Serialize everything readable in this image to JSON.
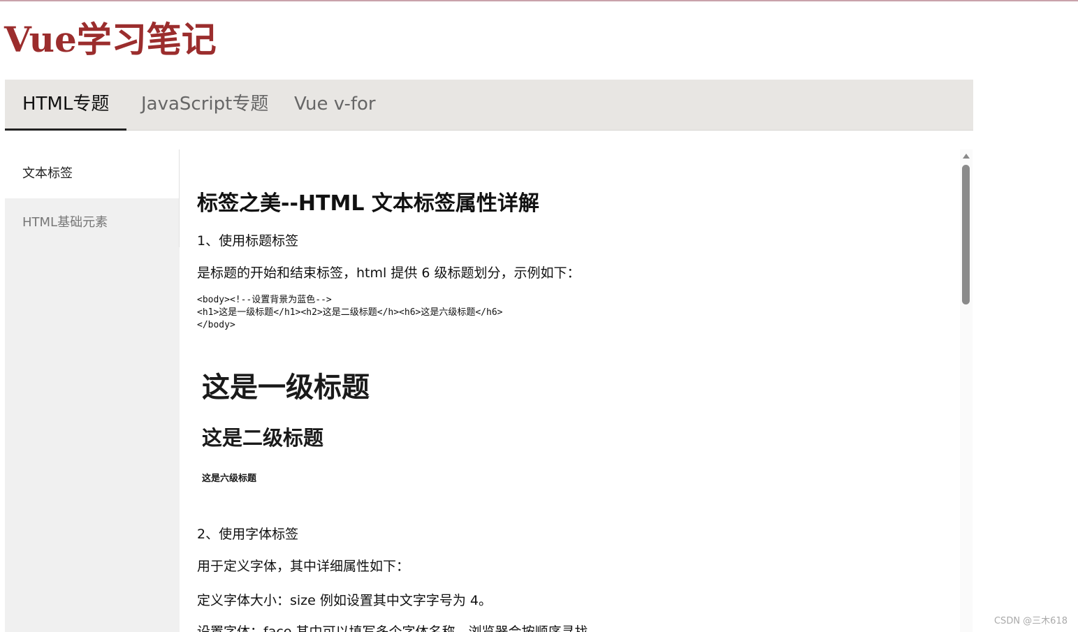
{
  "site": {
    "title": "Vue学习笔记"
  },
  "nav": {
    "tabs": [
      {
        "label": "HTML专题",
        "active": true
      },
      {
        "label": "JavaScript专题",
        "active": false
      },
      {
        "label": "Vue v-for",
        "active": false
      }
    ]
  },
  "sidebar": {
    "items": [
      {
        "label": "文本标签",
        "active": true
      },
      {
        "label": "HTML基础元素",
        "active": false
      }
    ]
  },
  "article": {
    "title": "标签之美--HTML 文本标签属性详解",
    "section1_heading": "1、使用标题标签",
    "section1_desc": "是标题的开始和结束标签，html 提供 6 级标题划分，示例如下：",
    "code_lines": [
      "<body><!--设置背景为蓝色-->",
      "<h1>这是一级标题</h1><h2>这是二级标题</h><h6>这是六级标题</h6>",
      "</body>"
    ],
    "demo_h1": "这是一级标题",
    "demo_h2": "这是二级标题",
    "demo_h6": "这是六级标题",
    "section2_heading": "2、使用字体标签",
    "section2_desc": "用于定义字体，其中详细属性如下：",
    "font_size_desc": "定义字体大小：size  例如设置其中文字字号为 4。",
    "font_face_desc": "设置字体：face 其中可以填写多个字体名称，浏览器会按顺序寻找"
  },
  "watermark": "CSDN @三木618",
  "colors": {
    "title": "#9b2d2d",
    "nav_bg": "#e8e6e3",
    "sidebar_bg": "#f0f0f0"
  }
}
